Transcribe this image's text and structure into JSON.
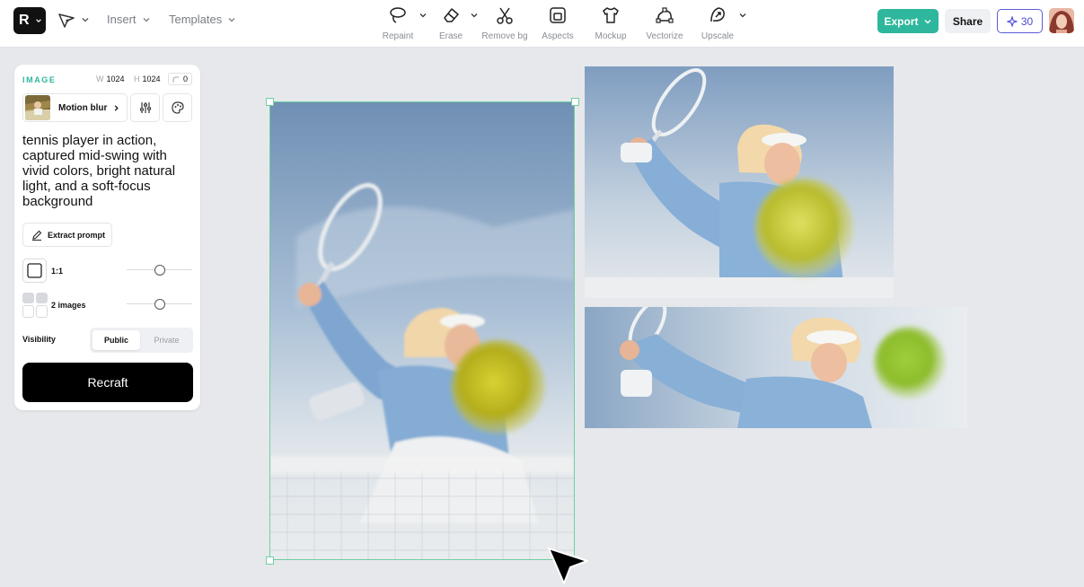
{
  "topbar": {
    "logo_letter": "R",
    "menu": {
      "insert": "Insert",
      "templates": "Templates"
    },
    "tools": [
      {
        "label": "Repaint",
        "icon": "lasso-icon"
      },
      {
        "label": "Erase",
        "icon": "eraser-icon"
      },
      {
        "label": "Remove bg",
        "icon": "scissors-icon"
      },
      {
        "label": "Aspects",
        "icon": "aspect-icon"
      },
      {
        "label": "Mockup",
        "icon": "shirt-icon"
      },
      {
        "label": "Vectorize",
        "icon": "vectorize-icon"
      },
      {
        "label": "Upscale",
        "icon": "upscale-icon"
      }
    ],
    "export_label": "Export",
    "share_label": "Share",
    "credits": "30"
  },
  "panel": {
    "section_label": "IMAGE",
    "width_key": "W",
    "width": "1024",
    "height_key": "H",
    "height": "1024",
    "corner_radius": "0",
    "style_name": "Motion blur",
    "prompt": "tennis player in action, captured mid-swing with vivid colors, bright natural light, and a soft-focus background",
    "extract_label": "Extract prompt",
    "aspect_label": "1:1",
    "aspect_slider": 0.5,
    "images_label": "2 images",
    "images_slider": 0.5,
    "visibility_label": "Visibility",
    "visibility_options": [
      "Public",
      "Private"
    ],
    "visibility_selected": "Public",
    "recraft_label": "Recraft"
  },
  "colors": {
    "accent": "#2eb79c",
    "selection": "#6fcf9f",
    "credits": "#4a4ad0",
    "canvas": "#e7e8ec"
  }
}
